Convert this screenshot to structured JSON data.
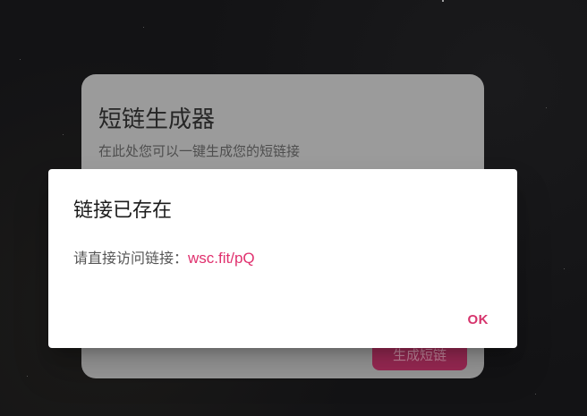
{
  "background_card": {
    "title": "短链生成器",
    "subtitle": "在此处您可以一键生成您的短链接",
    "generate_button_label": "生成短链"
  },
  "dialog": {
    "title": "链接已存在",
    "body_prefix": "请直接访问链接：",
    "link_text": "wsc.fit/pQ",
    "ok_label": "OK"
  },
  "colors": {
    "accent": "#e0306e",
    "card_background": "#9b9b9b",
    "page_background": "#131315"
  }
}
